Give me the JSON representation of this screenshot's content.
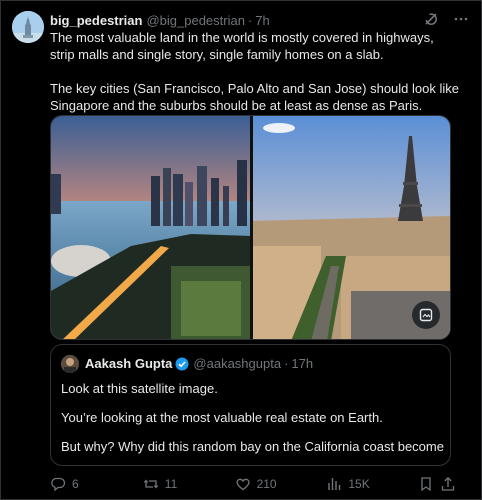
{
  "post": {
    "display_name": "big_pedestrian",
    "handle": "@big_pedestrian",
    "separator": "·",
    "time": "7h",
    "text": "The most valuable land in the world is mostly covered in highways, strip malls and single story, single family homes on a slab.\n\nThe key cities (San Francisco, Palo Alto and San Jose) should look like Singapore and the suburbs should be at least as dense as Paris."
  },
  "quote": {
    "display_name": "Aakash Gupta",
    "handle": "@aakashgupta",
    "separator": "·",
    "time": "17h",
    "lines": [
      "Look at this satellite image.",
      "You’re looking at the most valuable real estate on Earth.",
      "But why? Why did this random bay on the California coast become the..."
    ]
  },
  "actions": {
    "replies": "6",
    "reposts": "11",
    "likes": "210",
    "views": "15K"
  },
  "icons": {
    "header": [
      "grok-icon",
      "more-icon"
    ],
    "media": [
      "alt-edit-icon"
    ],
    "actions": [
      "reply-icon",
      "repost-icon",
      "like-icon",
      "views-icon",
      "bookmark-icon",
      "share-icon"
    ]
  },
  "colors": {
    "background": "#000000",
    "text": "#e7e9ea",
    "muted": "#71767b",
    "border": "#2f3336",
    "verified": "#1d9bf0"
  }
}
